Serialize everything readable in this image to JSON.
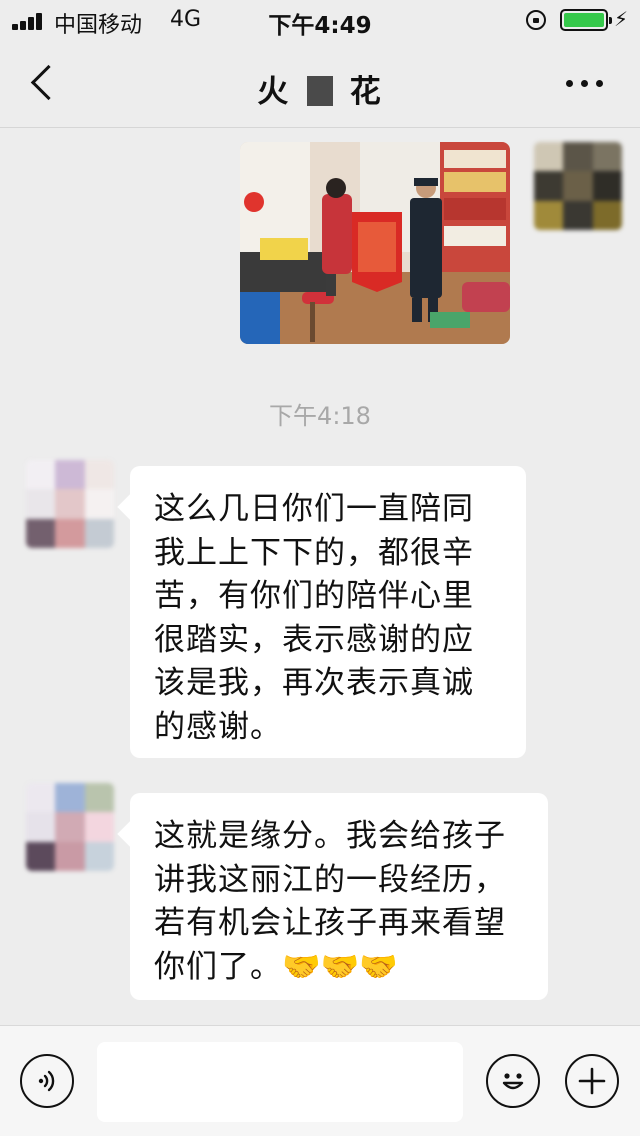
{
  "status_bar": {
    "carrier": "中国移动",
    "network": "4G",
    "time": "下午4:49",
    "battery_color": "#35c84a",
    "icons": [
      "signal-icon",
      "rotation-lock-icon",
      "battery-icon",
      "charging-icon"
    ]
  },
  "nav": {
    "title_left": "火",
    "title_right": "花",
    "back_icon": "chevron-left-icon",
    "more_icon": "more-dots-icon"
  },
  "messages": {
    "timestamp": "下午4:18",
    "first": "这么几日你们一直陪同我上上下下的，都很辛苦，有你们的陪伴心里很踏实，表示感谢的应该是我，再次表示真诚的感谢。",
    "second_text": "这就是缘分。我会给孩子讲我这丽江的一段经历，若有机会让孩子再来看望你们了。",
    "second_emojis": "🤝🤝🤝"
  },
  "input_bar": {
    "placeholder": "",
    "icons": [
      "voice-icon",
      "smiley-icon",
      "plus-icon"
    ]
  },
  "colors": {
    "background": "#ededed",
    "bubble": "#ffffff",
    "timestamp": "#a8a8a8"
  }
}
